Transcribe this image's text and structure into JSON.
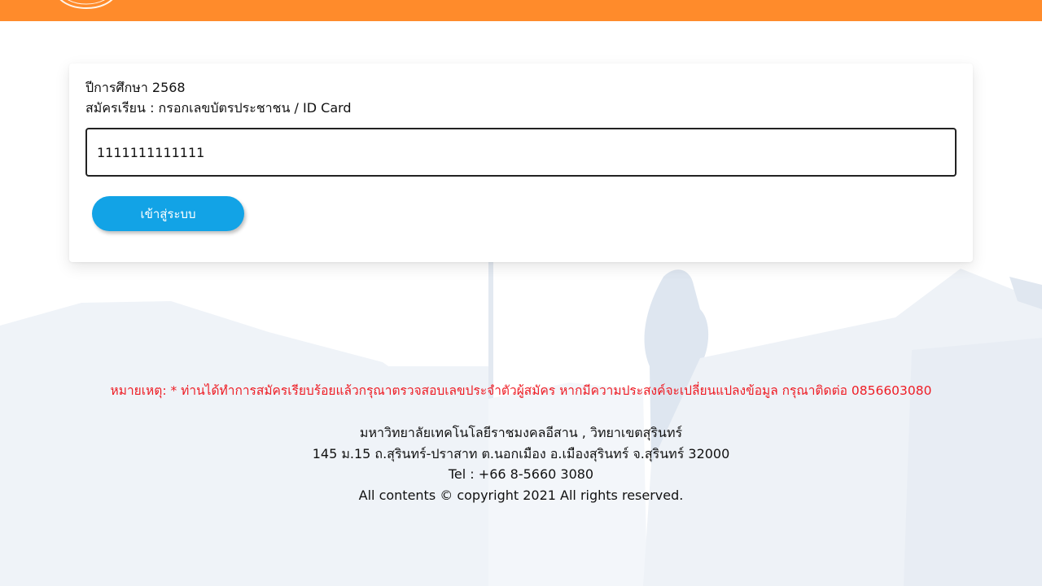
{
  "header": {
    "bg_color": "#ff8b2b",
    "logo": "university-seal-logo"
  },
  "card": {
    "academic_year": "ปีการศึกษา 2568",
    "instruction": "สมัครเรียน : กรอกเลขบัตรประชาชน / ID Card",
    "id_input_value": "1111111111111",
    "login_button": "เข้าสู่ระบบ"
  },
  "note": "หมายเหตุ: * ท่านได้ทำการสมัครเรียบร้อยแล้วกรุณาตรวจสอบเลขประจำตัวผู้สมัคร หากมีความประสงค์จะเปลี่ยนแปลงข้อมูล กรุณาติดต่อ 0856603080",
  "footer": {
    "university": "มหาวิทยาลัยเทคโนโลยีราชมงคลอีสาน , วิทยาเขตสุรินทร์",
    "address": "145 ม.15 ถ.สุรินทร์-ปราสาท ต.นอกเมือง อ.เมืองสุรินทร์ จ.สุรินทร์ 32000",
    "tel": "Tel : +66 8-5660 3080",
    "copyright": "All contents © copyright 2021 All rights reserved."
  },
  "colors": {
    "accent": "#ff8b2b",
    "button": "#12a3e6",
    "note": "#ee1c24"
  }
}
